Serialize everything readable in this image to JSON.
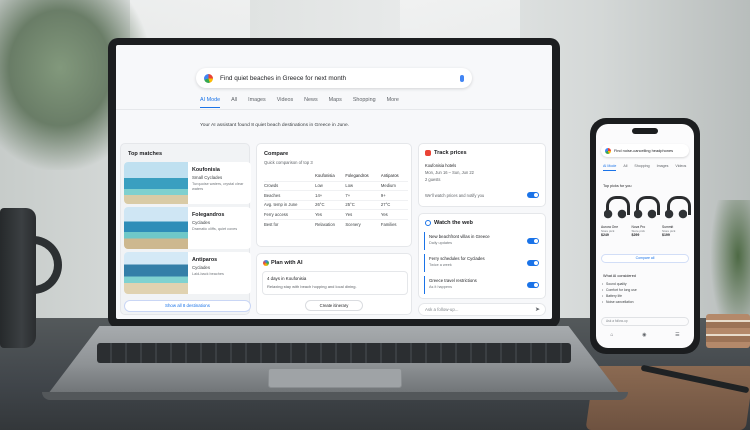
{
  "search": {
    "query": "Find quiet beaches in Greece for next month"
  },
  "tabs": [
    "AI Mode",
    "All",
    "Images",
    "Videos",
    "News",
    "Maps",
    "Shopping",
    "More"
  ],
  "status_text": "Your AI assistant found 8 quiet beach destinations in Greece in June.",
  "top_matches": {
    "title": "Top matches",
    "items": [
      {
        "name": "Koufonisia",
        "region": "Small Cyclades",
        "desc": "Turquoise waters, crystal clear waters"
      },
      {
        "name": "Folegandros",
        "region": "Cyclades",
        "desc": "Dramatic cliffs, quiet coves"
      },
      {
        "name": "Antiparos",
        "region": "Cyclades",
        "desc": "Laid-back beaches"
      }
    ],
    "show_all": "Show all 8 destinations"
  },
  "compare": {
    "title": "Compare",
    "subtitle": "Quick comparison of top 3",
    "columns": [
      "",
      "Koufonisia",
      "Folegandros",
      "Antiparos"
    ],
    "rows": [
      [
        "Crowds",
        "Low",
        "Low",
        "Medium"
      ],
      [
        "Beaches",
        "14+",
        "7+",
        "9+"
      ],
      [
        "Avg. temp in June",
        "26°C",
        "25°C",
        "27°C"
      ],
      [
        "Ferry access",
        "Yes",
        "Yes",
        "Yes"
      ],
      [
        "Best for",
        "Relaxation",
        "Scenery",
        "Families"
      ]
    ]
  },
  "plan": {
    "title": "Plan with AI",
    "card_title": "4 days in Koufonisia",
    "card_desc": "Relaxing stay with beach hopping and local dining.",
    "button": "Create itinerary"
  },
  "track_prices": {
    "title": "Track prices",
    "line1": "Koufonisia hotels",
    "line2": "Mon, Jun 16 – Sun, Jun 22",
    "line3": "2 guests",
    "line4": "We'll watch prices and notify you"
  },
  "watch": {
    "title": "Watch the web",
    "items": [
      {
        "title": "New beachfront villas in Greece",
        "sub": "Daily updates"
      },
      {
        "title": "Ferry schedules for Cyclades",
        "sub": "Twice a week"
      },
      {
        "title": "Greece travel restrictions",
        "sub": "As it happens"
      }
    ]
  },
  "followup_placeholder": "Ask a follow-up...",
  "phone": {
    "query": "Find noise-cancelling headphones",
    "tabs": [
      "AI Mode",
      "All",
      "Shopping",
      "Images",
      "Videos"
    ],
    "section_title": "Top picks for you",
    "products": [
      {
        "name": "Aurora One",
        "store": "Store pick",
        "price": "$249"
      },
      {
        "name": "Nova Pro",
        "store": "Store pick",
        "price": "$299"
      },
      {
        "name": "Summit",
        "store": "Store pick",
        "price": "$199"
      }
    ],
    "compare_all": "Compare all",
    "criteria_title": "What AI considered",
    "criteria": [
      "Sound quality",
      "Comfort for long use",
      "Battery life",
      "Noise cancellation"
    ],
    "followup": "Ask a follow-up"
  },
  "colors": {
    "accent": "#1a73e8",
    "text": "#202124",
    "muted": "#70757a"
  }
}
